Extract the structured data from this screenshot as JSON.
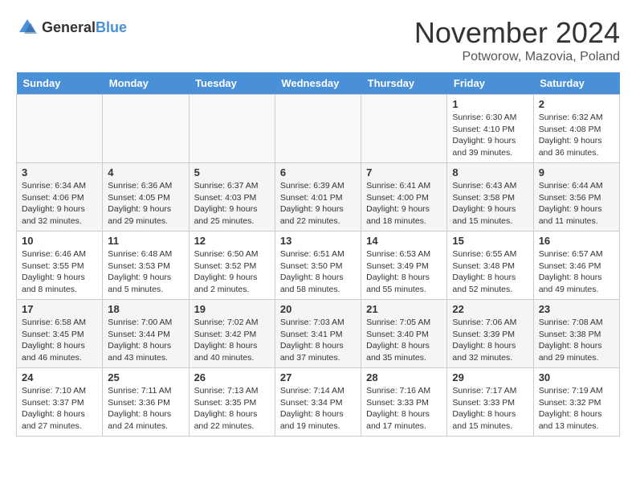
{
  "logo": {
    "general": "General",
    "blue": "Blue"
  },
  "title": "November 2024",
  "location": "Potworow, Mazovia, Poland",
  "days_header": [
    "Sunday",
    "Monday",
    "Tuesday",
    "Wednesday",
    "Thursday",
    "Friday",
    "Saturday"
  ],
  "weeks": [
    [
      {
        "day": "",
        "info": ""
      },
      {
        "day": "",
        "info": ""
      },
      {
        "day": "",
        "info": ""
      },
      {
        "day": "",
        "info": ""
      },
      {
        "day": "",
        "info": ""
      },
      {
        "day": "1",
        "info": "Sunrise: 6:30 AM\nSunset: 4:10 PM\nDaylight: 9 hours and 39 minutes."
      },
      {
        "day": "2",
        "info": "Sunrise: 6:32 AM\nSunset: 4:08 PM\nDaylight: 9 hours and 36 minutes."
      }
    ],
    [
      {
        "day": "3",
        "info": "Sunrise: 6:34 AM\nSunset: 4:06 PM\nDaylight: 9 hours and 32 minutes."
      },
      {
        "day": "4",
        "info": "Sunrise: 6:36 AM\nSunset: 4:05 PM\nDaylight: 9 hours and 29 minutes."
      },
      {
        "day": "5",
        "info": "Sunrise: 6:37 AM\nSunset: 4:03 PM\nDaylight: 9 hours and 25 minutes."
      },
      {
        "day": "6",
        "info": "Sunrise: 6:39 AM\nSunset: 4:01 PM\nDaylight: 9 hours and 22 minutes."
      },
      {
        "day": "7",
        "info": "Sunrise: 6:41 AM\nSunset: 4:00 PM\nDaylight: 9 hours and 18 minutes."
      },
      {
        "day": "8",
        "info": "Sunrise: 6:43 AM\nSunset: 3:58 PM\nDaylight: 9 hours and 15 minutes."
      },
      {
        "day": "9",
        "info": "Sunrise: 6:44 AM\nSunset: 3:56 PM\nDaylight: 9 hours and 11 minutes."
      }
    ],
    [
      {
        "day": "10",
        "info": "Sunrise: 6:46 AM\nSunset: 3:55 PM\nDaylight: 9 hours and 8 minutes."
      },
      {
        "day": "11",
        "info": "Sunrise: 6:48 AM\nSunset: 3:53 PM\nDaylight: 9 hours and 5 minutes."
      },
      {
        "day": "12",
        "info": "Sunrise: 6:50 AM\nSunset: 3:52 PM\nDaylight: 9 hours and 2 minutes."
      },
      {
        "day": "13",
        "info": "Sunrise: 6:51 AM\nSunset: 3:50 PM\nDaylight: 8 hours and 58 minutes."
      },
      {
        "day": "14",
        "info": "Sunrise: 6:53 AM\nSunset: 3:49 PM\nDaylight: 8 hours and 55 minutes."
      },
      {
        "day": "15",
        "info": "Sunrise: 6:55 AM\nSunset: 3:48 PM\nDaylight: 8 hours and 52 minutes."
      },
      {
        "day": "16",
        "info": "Sunrise: 6:57 AM\nSunset: 3:46 PM\nDaylight: 8 hours and 49 minutes."
      }
    ],
    [
      {
        "day": "17",
        "info": "Sunrise: 6:58 AM\nSunset: 3:45 PM\nDaylight: 8 hours and 46 minutes."
      },
      {
        "day": "18",
        "info": "Sunrise: 7:00 AM\nSunset: 3:44 PM\nDaylight: 8 hours and 43 minutes."
      },
      {
        "day": "19",
        "info": "Sunrise: 7:02 AM\nSunset: 3:42 PM\nDaylight: 8 hours and 40 minutes."
      },
      {
        "day": "20",
        "info": "Sunrise: 7:03 AM\nSunset: 3:41 PM\nDaylight: 8 hours and 37 minutes."
      },
      {
        "day": "21",
        "info": "Sunrise: 7:05 AM\nSunset: 3:40 PM\nDaylight: 8 hours and 35 minutes."
      },
      {
        "day": "22",
        "info": "Sunrise: 7:06 AM\nSunset: 3:39 PM\nDaylight: 8 hours and 32 minutes."
      },
      {
        "day": "23",
        "info": "Sunrise: 7:08 AM\nSunset: 3:38 PM\nDaylight: 8 hours and 29 minutes."
      }
    ],
    [
      {
        "day": "24",
        "info": "Sunrise: 7:10 AM\nSunset: 3:37 PM\nDaylight: 8 hours and 27 minutes."
      },
      {
        "day": "25",
        "info": "Sunrise: 7:11 AM\nSunset: 3:36 PM\nDaylight: 8 hours and 24 minutes."
      },
      {
        "day": "26",
        "info": "Sunrise: 7:13 AM\nSunset: 3:35 PM\nDaylight: 8 hours and 22 minutes."
      },
      {
        "day": "27",
        "info": "Sunrise: 7:14 AM\nSunset: 3:34 PM\nDaylight: 8 hours and 19 minutes."
      },
      {
        "day": "28",
        "info": "Sunrise: 7:16 AM\nSunset: 3:33 PM\nDaylight: 8 hours and 17 minutes."
      },
      {
        "day": "29",
        "info": "Sunrise: 7:17 AM\nSunset: 3:33 PM\nDaylight: 8 hours and 15 minutes."
      },
      {
        "day": "30",
        "info": "Sunrise: 7:19 AM\nSunset: 3:32 PM\nDaylight: 8 hours and 13 minutes."
      }
    ]
  ]
}
